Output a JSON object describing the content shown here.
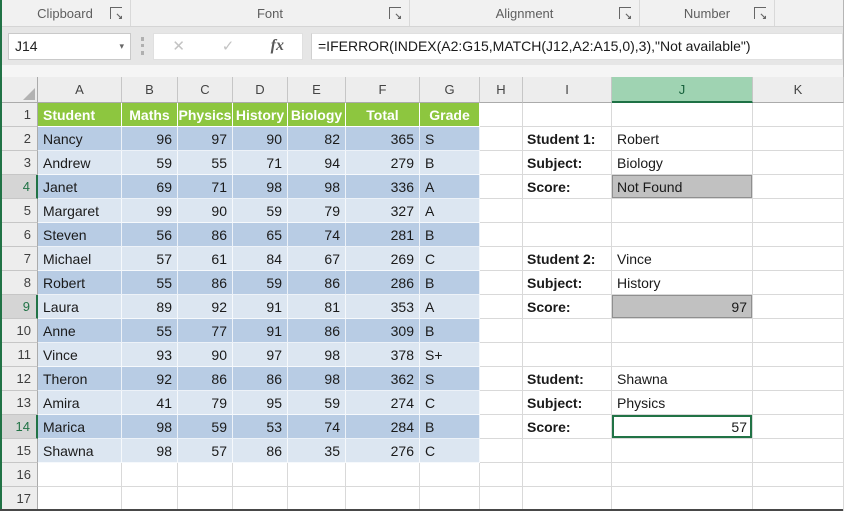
{
  "ribbon": {
    "groups": [
      {
        "label": "Clipboard"
      },
      {
        "label": "Font"
      },
      {
        "label": "Alignment"
      },
      {
        "label": "Number"
      }
    ],
    "launcher_icon": "dialog-launcher"
  },
  "formula_bar": {
    "name_box_value": "J14",
    "caret_icon": "▾",
    "cancel_icon": "✕",
    "enter_icon": "✓",
    "fx_label": "fx",
    "formula": "=IFERROR(INDEX(A2:G15,MATCH(J12,A2:A15,0),3),\"Not available\")"
  },
  "sheet": {
    "column_headers": [
      "A",
      "B",
      "C",
      "D",
      "E",
      "F",
      "G",
      "H",
      "I",
      "J",
      "K"
    ],
    "selected_column": "J",
    "selected_rows": [
      4,
      9,
      14
    ],
    "row_count": 17,
    "colors": {
      "table_header_green": "#8dc63f",
      "band_dark_blue": "#b8cce4",
      "band_light_blue": "#dce6f1",
      "selection_green": "#217346",
      "selected_header_fill": "#9fd3b2",
      "gray_cell_fill": "#c1c1c1"
    },
    "table": {
      "headers": [
        "Student",
        "Maths",
        "Physics",
        "History",
        "Biology",
        "Total",
        "Grade"
      ],
      "rows": [
        [
          "Nancy",
          96,
          97,
          90,
          82,
          365,
          "S"
        ],
        [
          "Andrew",
          59,
          55,
          71,
          94,
          279,
          "B"
        ],
        [
          "Janet",
          69,
          71,
          98,
          98,
          336,
          "A"
        ],
        [
          "Margaret",
          99,
          90,
          59,
          79,
          327,
          "A"
        ],
        [
          "Steven",
          56,
          86,
          65,
          74,
          281,
          "B"
        ],
        [
          "Michael",
          57,
          61,
          84,
          67,
          269,
          "C"
        ],
        [
          "Robert",
          55,
          86,
          59,
          86,
          286,
          "B"
        ],
        [
          "Laura",
          89,
          92,
          91,
          81,
          353,
          "A"
        ],
        [
          "Anne",
          55,
          77,
          91,
          86,
          309,
          "B"
        ],
        [
          "Vince",
          93,
          90,
          97,
          98,
          378,
          "S+"
        ],
        [
          "Theron",
          92,
          86,
          86,
          98,
          362,
          "S"
        ],
        [
          "Amira",
          41,
          79,
          95,
          59,
          274,
          "C"
        ],
        [
          "Marica",
          98,
          59,
          53,
          74,
          284,
          "B"
        ],
        [
          "Shawna",
          98,
          57,
          86,
          35,
          276,
          "C"
        ]
      ]
    },
    "lookups": [
      {
        "row": 2,
        "label": "Student 1:",
        "value": "Robert",
        "style": "plain"
      },
      {
        "row": 3,
        "label": "Subject:",
        "value": "Biology",
        "style": "plain"
      },
      {
        "row": 4,
        "label": "Score:",
        "value": "Not Found",
        "style": "gray-text"
      },
      {
        "row": 7,
        "label": "Student 2:",
        "value": "Vince",
        "style": "plain"
      },
      {
        "row": 8,
        "label": "Subject:",
        "value": "History",
        "style": "plain"
      },
      {
        "row": 9,
        "label": "Score:",
        "value": "97",
        "style": "gray-num"
      },
      {
        "row": 12,
        "label": "Student:",
        "value": "Shawna",
        "style": "plain"
      },
      {
        "row": 13,
        "label": "Subject:",
        "value": "Physics",
        "style": "plain"
      },
      {
        "row": 14,
        "label": "Score:",
        "value": "57",
        "style": "active-num"
      }
    ]
  }
}
